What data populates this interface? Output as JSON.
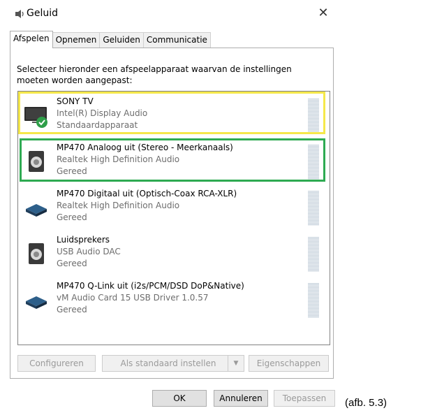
{
  "window": {
    "title": "Geluid",
    "close_icon": "close-icon"
  },
  "tabs": [
    {
      "label": "Afspelen",
      "active": true
    },
    {
      "label": "Opnemen",
      "active": false
    },
    {
      "label": "Geluiden",
      "active": false
    },
    {
      "label": "Communicatie",
      "active": false
    }
  ],
  "instruction": "Selecteer hieronder een afspeelapparaat waarvan de instellingen moeten worden aangepast:",
  "devices": [
    {
      "name": "SONY TV",
      "driver": "Intel(R) Display Audio",
      "status": "Standaardapparaat",
      "icon": "monitor-icon",
      "default": true
    },
    {
      "name": "MP470 Analoog uit (Stereo - Meerkanaals)",
      "driver": "Realtek High Definition Audio",
      "status": "Gereed",
      "icon": "speaker-icon"
    },
    {
      "name": "MP470 Digitaal uit (Optisch-Coax RCA-XLR)",
      "driver": "Realtek High Definition Audio",
      "status": "Gereed",
      "icon": "digital-output-icon"
    },
    {
      "name": "Luidsprekers",
      "driver": "USB Audio DAC",
      "status": "Gereed",
      "icon": "speaker-icon"
    },
    {
      "name": "MP470 Q-Link uit (i2s/PCM/DSD DoP&Native)",
      "driver": "vM Audio Card 15 USB Driver 1.0.57",
      "status": "Gereed",
      "icon": "digital-output-icon"
    }
  ],
  "buttons": {
    "configure": "Configureren",
    "set_default": "Als standaard instellen",
    "properties": "Eigenschappen",
    "ok": "OK",
    "cancel": "Annuleren",
    "apply": "Toepassen"
  },
  "highlights": {
    "yellow": "#f5e84a",
    "green": "#2eaa52"
  },
  "caption": "(afb. 5.3)"
}
